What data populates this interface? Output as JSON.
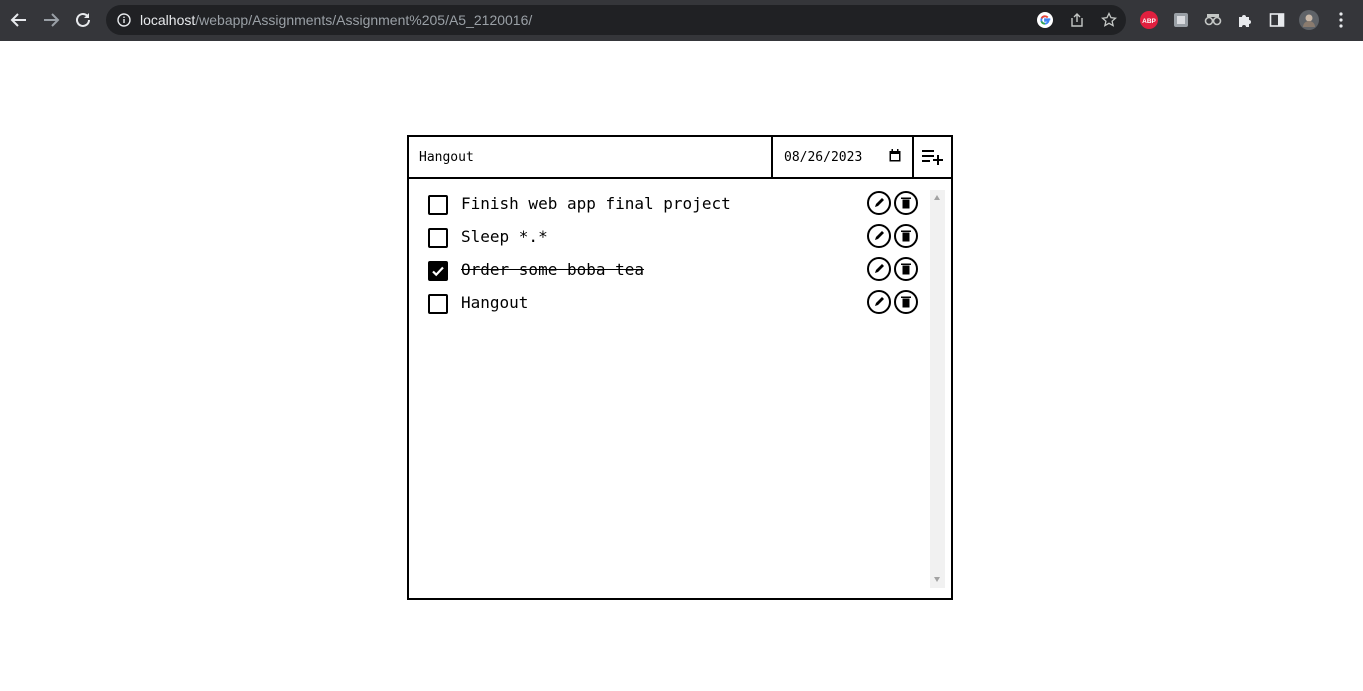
{
  "browser": {
    "url_host": "localhost",
    "url_path": "/webapp/Assignments/Assignment%205/A5_2120016/",
    "extensions": [
      "abp-icon",
      "extension-icon",
      "incognito-glasses-icon",
      "puzzle-icon"
    ],
    "adblock_badge": "ABP"
  },
  "app": {
    "task_input_value": "Hangout",
    "date_value": "08/26/2023",
    "tasks": [
      {
        "label": "Finish web app final project",
        "done": false
      },
      {
        "label": "Sleep *.*",
        "done": false
      },
      {
        "label": "Order some boba tea",
        "done": true
      },
      {
        "label": "Hangout",
        "done": false
      }
    ]
  },
  "colors": {
    "chrome_bg": "#35363a",
    "omnibox_bg": "#202124",
    "abp_red": "#e0203f",
    "ink": "#000000"
  }
}
